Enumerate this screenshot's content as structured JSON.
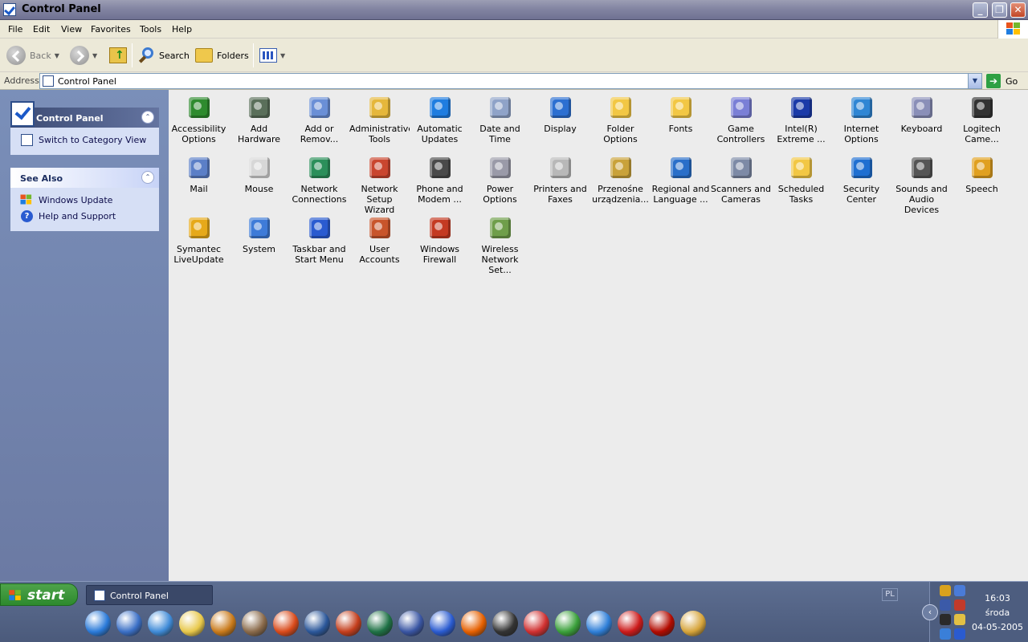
{
  "window": {
    "title": "Control Panel"
  },
  "menu": [
    "File",
    "Edit",
    "View",
    "Favorites",
    "Tools",
    "Help"
  ],
  "toolbar": {
    "back": "Back",
    "search": "Search",
    "folders": "Folders"
  },
  "address": {
    "label": "Address",
    "value": "Control Panel",
    "go": "Go"
  },
  "sidebar": {
    "control_panel": {
      "title": "Control Panel",
      "tasks": [
        "Switch to Category View"
      ]
    },
    "see_also": {
      "title": "See Also",
      "links": [
        "Windows Update",
        "Help and Support"
      ]
    }
  },
  "items": [
    {
      "label": "Accessibility\nOptions",
      "icon": "accessibility-icon",
      "color": "#2e8b2e"
    },
    {
      "label": "Add Hardware",
      "icon": "add-hardware-icon",
      "color": "#5a6f5a"
    },
    {
      "label": "Add or\nRemov...",
      "icon": "add-remove-programs-icon",
      "color": "#6a8fd6"
    },
    {
      "label": "Administrative\nTools",
      "icon": "administrative-tools-icon",
      "color": "#e5b73b"
    },
    {
      "label": "Automatic\nUpdates",
      "icon": "automatic-updates-icon",
      "color": "#1f7de0"
    },
    {
      "label": "Date and Time",
      "icon": "date-time-icon",
      "color": "#8fa3c8"
    },
    {
      "label": "Display",
      "icon": "display-icon",
      "color": "#2c6fd1"
    },
    {
      "label": "Folder Options",
      "icon": "folder-options-icon",
      "color": "#f2c744"
    },
    {
      "label": "Fonts",
      "icon": "fonts-icon",
      "color": "#f2c744"
    },
    {
      "label": "Game\nControllers",
      "icon": "game-controllers-icon",
      "color": "#7a7fd6"
    },
    {
      "label": "Intel(R)\nExtreme ...",
      "icon": "intel-graphics-icon",
      "color": "#1a3aa8"
    },
    {
      "label": "Internet\nOptions",
      "icon": "internet-options-icon",
      "color": "#2f86d4"
    },
    {
      "label": "Keyboard",
      "icon": "keyboard-icon",
      "color": "#8a8fb8"
    },
    {
      "label": "Logitech\nCame...",
      "icon": "logitech-camera-icon",
      "color": "#333333"
    },
    {
      "label": "Mail",
      "icon": "mail-icon",
      "color": "#5b7fc7"
    },
    {
      "label": "Mouse",
      "icon": "mouse-icon",
      "color": "#d7d7d7"
    },
    {
      "label": "Network\nConnections",
      "icon": "network-connections-icon",
      "color": "#2b8f5a"
    },
    {
      "label": "Network Setup\nWizard",
      "icon": "network-setup-wizard-icon",
      "color": "#c9462f"
    },
    {
      "label": "Phone and\nModem ...",
      "icon": "phone-modem-icon",
      "color": "#4a4a4a"
    },
    {
      "label": "Power Options",
      "icon": "power-options-icon",
      "color": "#9a9aa8"
    },
    {
      "label": "Printers and\nFaxes",
      "icon": "printers-faxes-icon",
      "color": "#b8b8b8"
    },
    {
      "label": "Przenośne\nurządzenia...",
      "icon": "portable-devices-icon",
      "color": "#c9a23a"
    },
    {
      "label": "Regional and\nLanguage ...",
      "icon": "regional-language-icon",
      "color": "#2a6fc9"
    },
    {
      "label": "Scanners and\nCameras",
      "icon": "scanners-cameras-icon",
      "color": "#7d8aa6"
    },
    {
      "label": "Scheduled\nTasks",
      "icon": "scheduled-tasks-icon",
      "color": "#f2c744"
    },
    {
      "label": "Security\nCenter",
      "icon": "security-center-icon",
      "color": "#1f6fd1"
    },
    {
      "label": "Sounds and\nAudio Devices",
      "icon": "sounds-audio-icon",
      "color": "#555555"
    },
    {
      "label": "Speech",
      "icon": "speech-icon",
      "color": "#e0a020"
    },
    {
      "label": "Symantec\nLiveUpdate",
      "icon": "symantec-liveupdate-icon",
      "color": "#e6a91a"
    },
    {
      "label": "System",
      "icon": "system-icon",
      "color": "#3e7bd8"
    },
    {
      "label": "Taskbar and\nStart Menu",
      "icon": "taskbar-start-menu-icon",
      "color": "#2a5bd0"
    },
    {
      "label": "User Accounts",
      "icon": "user-accounts-icon",
      "color": "#c8552b"
    },
    {
      "label": "Windows\nFirewall",
      "icon": "windows-firewall-icon",
      "color": "#c43a22"
    },
    {
      "label": "Wireless\nNetwork Set...",
      "icon": "wireless-network-setup-icon",
      "color": "#6f9e4a"
    }
  ],
  "taskbar": {
    "start": "start",
    "window_button": "Control Panel",
    "language": "PL",
    "clock": {
      "time": "16:03",
      "day": "środa",
      "date": "04-05-2005"
    },
    "quick_launch": [
      {
        "icon": "internet-explorer-icon",
        "color": "#2a7ad9"
      },
      {
        "icon": "show-desktop-icon",
        "color": "#3a6fc6"
      },
      {
        "icon": "media-player-icon",
        "color": "#3f8bd8"
      },
      {
        "icon": "search-folder-icon",
        "color": "#e8c84a"
      },
      {
        "icon": "globe-tool-icon",
        "color": "#c97a1a"
      },
      {
        "icon": "image-tool-icon",
        "color": "#8a6a4a"
      },
      {
        "icon": "cd-burner-icon",
        "color": "#d94a1a"
      },
      {
        "icon": "word-icon",
        "color": "#2b579a"
      },
      {
        "icon": "powerpoint-icon",
        "color": "#c43e1c"
      },
      {
        "icon": "excel-icon",
        "color": "#1e7145"
      },
      {
        "icon": "visio-icon",
        "color": "#3955a3"
      },
      {
        "icon": "messenger-icon",
        "color": "#2a5bd0"
      },
      {
        "icon": "firefox-icon",
        "color": "#e66000"
      },
      {
        "icon": "webcam-icon",
        "color": "#333333"
      },
      {
        "icon": "skype-icon",
        "color": "#d03030"
      },
      {
        "icon": "msn-icon",
        "color": "#3aa03a"
      },
      {
        "icon": "msn-alt-icon",
        "color": "#2f7fd8"
      },
      {
        "icon": "opera-icon",
        "color": "#cc1a1a"
      },
      {
        "icon": "acrobat-icon",
        "color": "#b30b00"
      },
      {
        "icon": "archive-icon",
        "color": "#d6a43a"
      }
    ]
  }
}
